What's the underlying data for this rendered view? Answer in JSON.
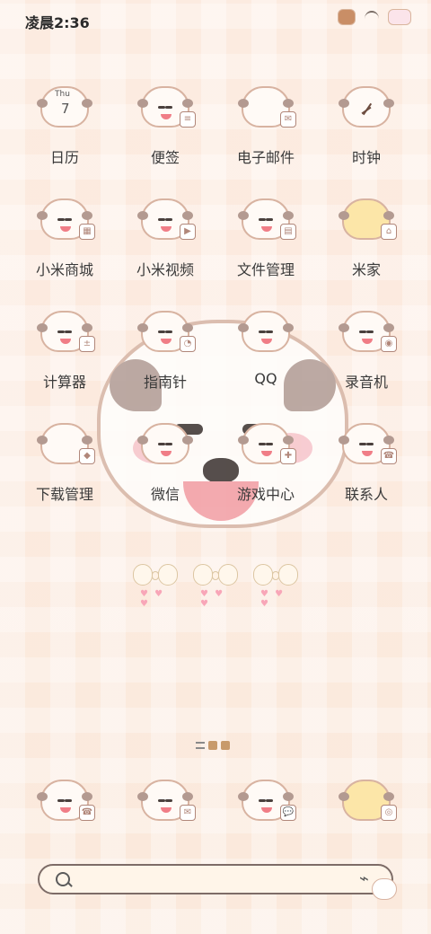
{
  "status_bar": {
    "time": "凌晨2:36",
    "icons": [
      "cake-icon",
      "wifi-icon",
      "battery-icon"
    ]
  },
  "home_screen": {
    "apps": [
      {
        "label": "日历",
        "icon": "calendar-icon",
        "calendar_weekday": "Thu",
        "calendar_day": "7"
      },
      {
        "label": "便签",
        "icon": "notes-icon"
      },
      {
        "label": "电子邮件",
        "icon": "email-icon"
      },
      {
        "label": "时钟",
        "icon": "clock-icon"
      },
      {
        "label": "小米商城",
        "icon": "mi-store-icon"
      },
      {
        "label": "小米视频",
        "icon": "mi-video-icon"
      },
      {
        "label": "文件管理",
        "icon": "file-manager-icon"
      },
      {
        "label": "米家",
        "icon": "mi-home-icon"
      },
      {
        "label": "计算器",
        "icon": "calculator-icon"
      },
      {
        "label": "指南针",
        "icon": "compass-icon"
      },
      {
        "label": "QQ",
        "icon": "qq-icon"
      },
      {
        "label": "录音机",
        "icon": "recorder-icon"
      },
      {
        "label": "下载管理",
        "icon": "download-manager-icon"
      },
      {
        "label": "微信",
        "icon": "wechat-icon"
      },
      {
        "label": "游戏中心",
        "icon": "game-center-icon"
      },
      {
        "label": "联系人",
        "icon": "contacts-icon"
      }
    ],
    "decorations": {
      "bow_hearts": [
        "♥ ♥ ♥",
        "♥ ♥ ♥",
        "♥ ♥ ♥"
      ]
    }
  },
  "page_indicator": {
    "pages": 3,
    "current": 2
  },
  "dock": {
    "apps": [
      {
        "icon": "phone-icon"
      },
      {
        "icon": "messages-icon"
      },
      {
        "icon": "chat-icon"
      },
      {
        "icon": "camera-icon"
      }
    ]
  },
  "search": {
    "placeholder": ""
  },
  "colors": {
    "background": "#fdeee4",
    "accent_brown": "#d8b3a1",
    "text": "#3a3a3a",
    "search_bar": "#fff5e9"
  }
}
